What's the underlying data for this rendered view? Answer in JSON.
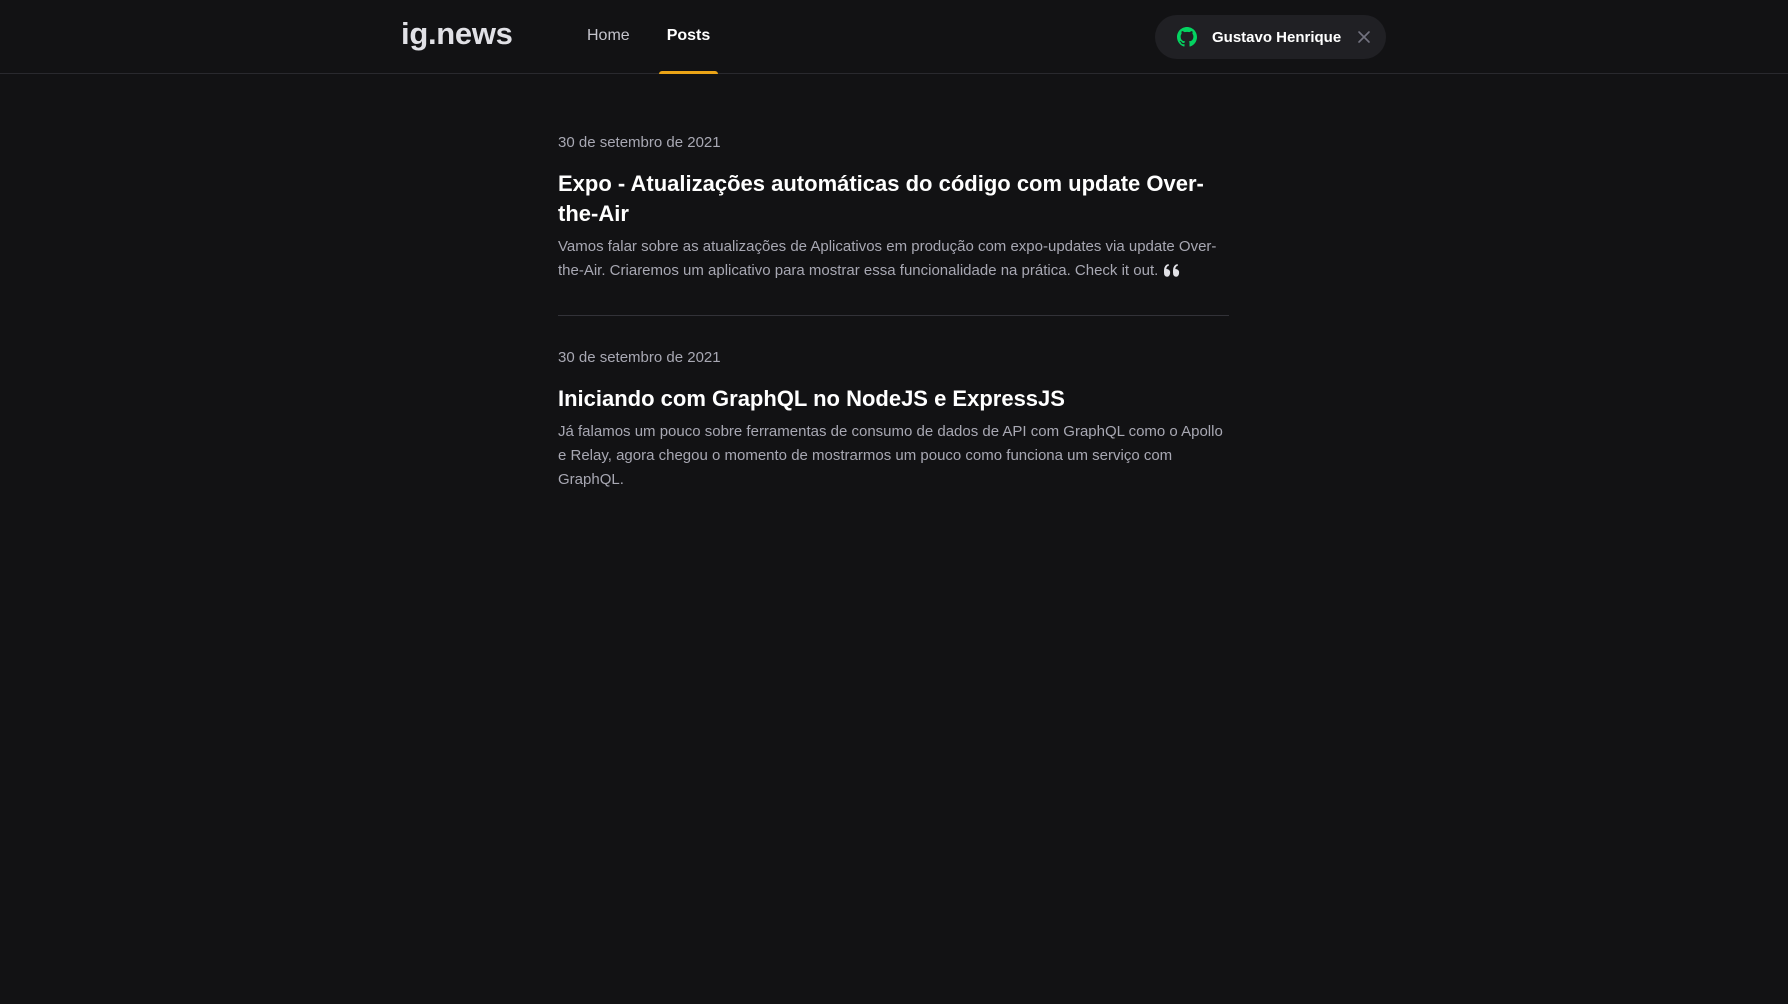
{
  "header": {
    "logo": "ig.news",
    "nav": [
      {
        "label": "Home",
        "active": false
      },
      {
        "label": "Posts",
        "active": true
      }
    ],
    "user": {
      "name": "Gustavo Henrique",
      "github_icon": "github-icon",
      "close_icon": "close-icon",
      "github_icon_color": "#04d361"
    },
    "accent_color": "#eba417"
  },
  "posts": [
    {
      "date": "30 de setembro de 2021",
      "title": "Expo - Atualizações automáticas do código com update Over-the-Air",
      "excerpt": "Vamos falar sobre as atualizações de Aplicativos em produção com expo-updates via update Over-the-Air. Criaremos um aplicativo para mostrar essa funcionalidade na prática. Check it out.",
      "trailing_icon": "quote-icon"
    },
    {
      "date": "30 de setembro de 2021",
      "title": "Iniciando com GraphQL no NodeJS e ExpressJS",
      "excerpt": "Já falamos um pouco sobre ferramentas de consumo de dados de API com GraphQL como o Apollo e Relay, agora chegou o momento de mostrarmos um pouco como funciona um serviço com GraphQL."
    }
  ]
}
